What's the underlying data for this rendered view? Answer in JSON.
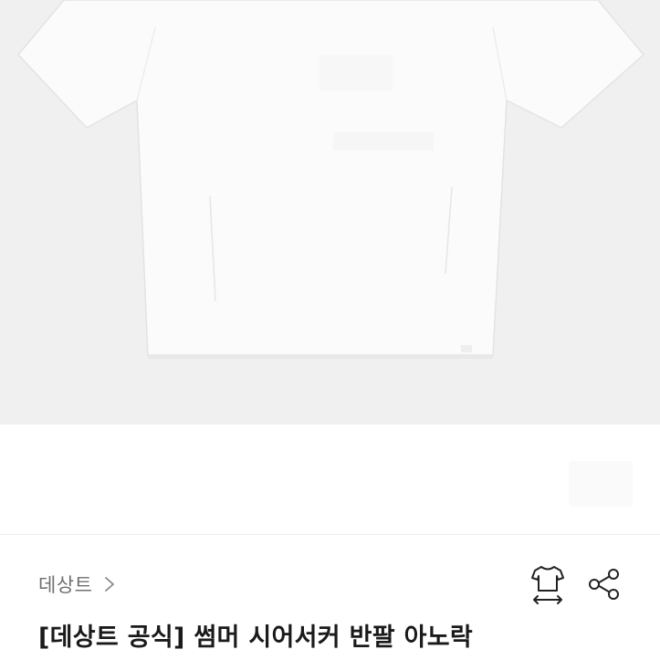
{
  "product": {
    "brand": "데상트",
    "title": "[데상트 공식] 썸머 시어서커 반팔 아노락"
  },
  "icons": {
    "brand_chevron": "chevron-right-icon",
    "size_guide": "tshirt-size-icon",
    "share": "share-icon"
  },
  "colors": {
    "image_background": "#f0f0f0",
    "garment": "#fbfbfb",
    "brand_text": "#6f6f6f",
    "title_text": "#1a1a1a"
  }
}
